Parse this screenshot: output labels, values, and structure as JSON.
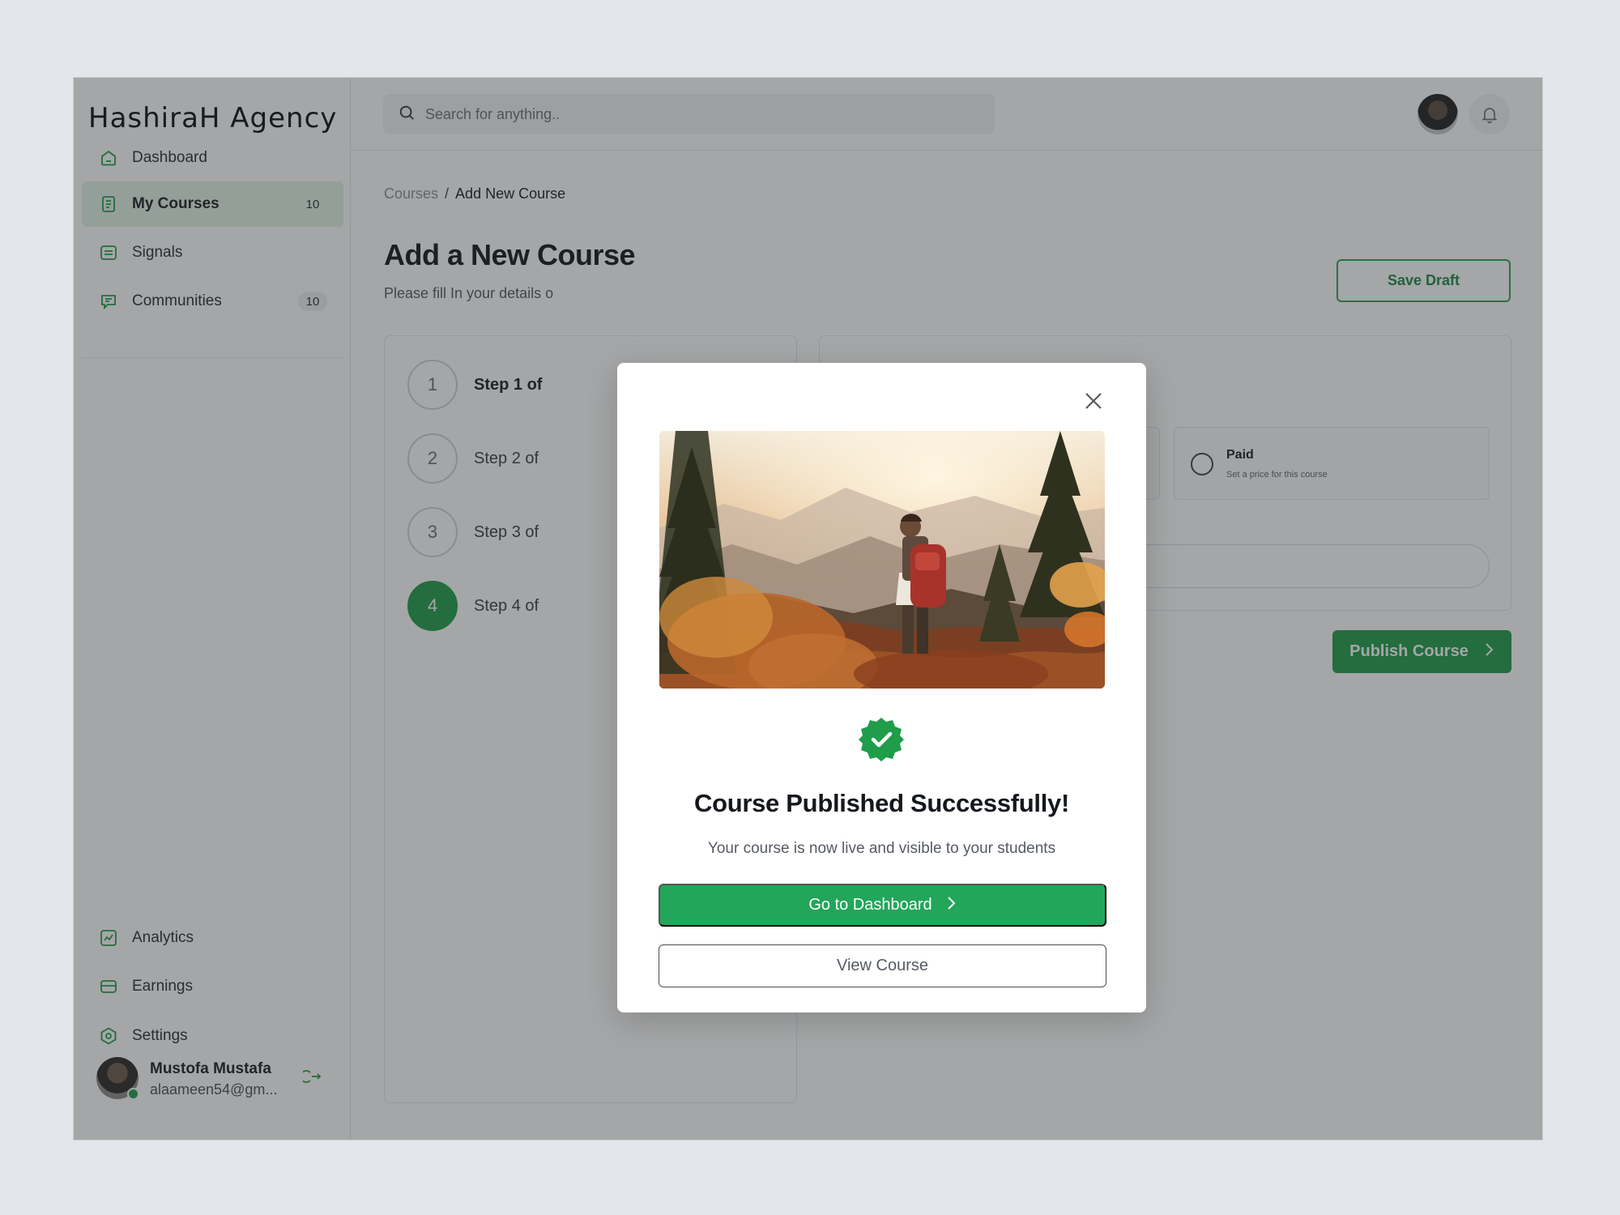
{
  "app": {
    "brand": "HashiraH Agency"
  },
  "sidebar": {
    "items": [
      {
        "label": "Dashboard",
        "icon": "home-icon"
      },
      {
        "label": "My Courses",
        "icon": "book-icon",
        "badge": "10",
        "active": true
      },
      {
        "label": "Signals",
        "icon": "signal-icon"
      },
      {
        "label": "Communities",
        "icon": "chat-icon",
        "badge": "10"
      }
    ],
    "bottom_items": [
      {
        "label": "Analytics",
        "icon": "chart-icon"
      },
      {
        "label": "Earnings",
        "icon": "card-icon"
      },
      {
        "label": "Settings",
        "icon": "gear-icon"
      }
    ],
    "user": {
      "name": "Mustofa Mustafa",
      "email": "alaameen54@gm..."
    }
  },
  "topbar": {
    "search_placeholder": "Search for anything.."
  },
  "content": {
    "breadcrumb": [
      "Courses",
      "Add New Course"
    ],
    "breadcrumb_sep": "/",
    "title": "Add a New Course",
    "subtitle": "Please fill In your details o",
    "save_draft": "Save Draft",
    "steps": [
      {
        "number": "1",
        "label": "Step 1 of"
      },
      {
        "number": "2",
        "label": "Step 2 of"
      },
      {
        "number": "3",
        "label": "Step 3 of"
      },
      {
        "number": "4",
        "label": "Step 4 of"
      }
    ],
    "pricing": {
      "paid_title": "Paid",
      "paid_desc": "Set a price for this course"
    },
    "publish": "Publish Course"
  },
  "modal": {
    "title": "Course Published Successfully!",
    "subtitle": "Your course is now live and visible to your students",
    "primary_button": "Go to Dashboard",
    "secondary_button": "View Course"
  },
  "colors": {
    "accent": "#1f9d4a",
    "accent_light": "#e4f3e8"
  }
}
